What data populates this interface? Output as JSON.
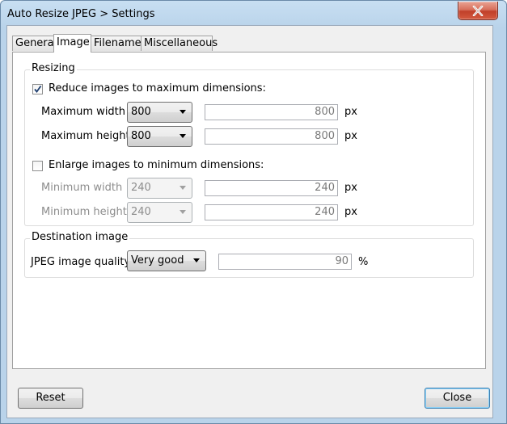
{
  "window": {
    "title": "Auto Resize JPEG > Settings"
  },
  "tabs": [
    {
      "label": "General"
    },
    {
      "label": "Image"
    },
    {
      "label": "Filename"
    },
    {
      "label": "Miscellaneous"
    }
  ],
  "resizing": {
    "title": "Resizing",
    "reduce": {
      "label": "Reduce images to maximum dimensions:",
      "checked": true,
      "width_label": "Maximum width",
      "width_option": "800",
      "width_value": "800",
      "height_label": "Maximum height",
      "height_option": "800",
      "height_value": "800",
      "unit": "px"
    },
    "enlarge": {
      "label": "Enlarge images to minimum dimensions:",
      "checked": false,
      "width_label": "Minimum width",
      "width_option": "240",
      "width_value": "240",
      "height_label": "Minimum height",
      "height_option": "240",
      "height_value": "240",
      "unit": "px"
    }
  },
  "destination": {
    "title": "Destination image",
    "quality_label": "JPEG image quality",
    "quality_option": "Very good",
    "quality_value": "90",
    "unit": "%"
  },
  "buttons": {
    "reset": "Reset",
    "close": "Close"
  }
}
